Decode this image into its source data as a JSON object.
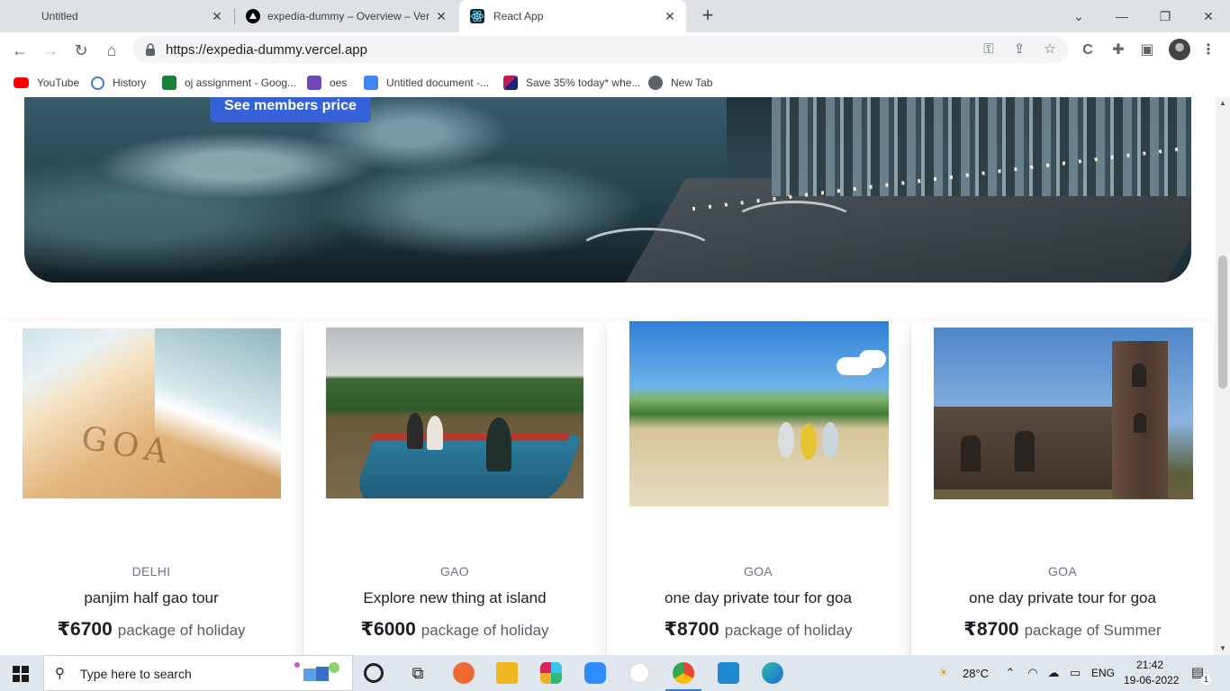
{
  "browser": {
    "tabs": [
      {
        "title": "Untitled"
      },
      {
        "title": "expedia-dummy – Overview – Vercel"
      },
      {
        "title": "React App"
      }
    ],
    "url": "https://expedia-dummy.vercel.app",
    "bookmarks": [
      {
        "label": "YouTube",
        "icon": "youtube-icon"
      },
      {
        "label": "History",
        "icon": "history-icon"
      },
      {
        "label": "oj assignment - Goog...",
        "icon": "sheets-icon"
      },
      {
        "label": "oes",
        "icon": "forms-icon"
      },
      {
        "label": "Untitled document -...",
        "icon": "docs-icon"
      },
      {
        "label": "Save 35% today* whe...",
        "icon": "promo-icon"
      },
      {
        "label": "New Tab",
        "icon": "globe-icon"
      }
    ]
  },
  "hero": {
    "button_label": "See members price"
  },
  "cards": [
    {
      "city": "DELHI",
      "title": "panjim half gao tour",
      "price": "₹6700",
      "desc": "package of holiday"
    },
    {
      "city": "GAO",
      "title": "Explore new thing at island",
      "price": "₹6000",
      "desc": "package of holiday"
    },
    {
      "city": "GOA",
      "title": "one day private tour for goa",
      "price": "₹8700",
      "desc": "package of holiday"
    },
    {
      "city": "GOA",
      "title": "one day private tour for goa",
      "price": "₹8700",
      "desc": "package of Summer"
    }
  ],
  "sand_text": "GOA",
  "taskbar": {
    "search_placeholder": "Type here to search",
    "temperature": "28°C",
    "language": "ENG",
    "time": "21:42",
    "date": "19-06-2022",
    "notification_count": "1"
  },
  "colors": {
    "accent_button": "#3662d8",
    "tab_strip": "#dee1e6",
    "taskbar": "#dfe6ee"
  }
}
